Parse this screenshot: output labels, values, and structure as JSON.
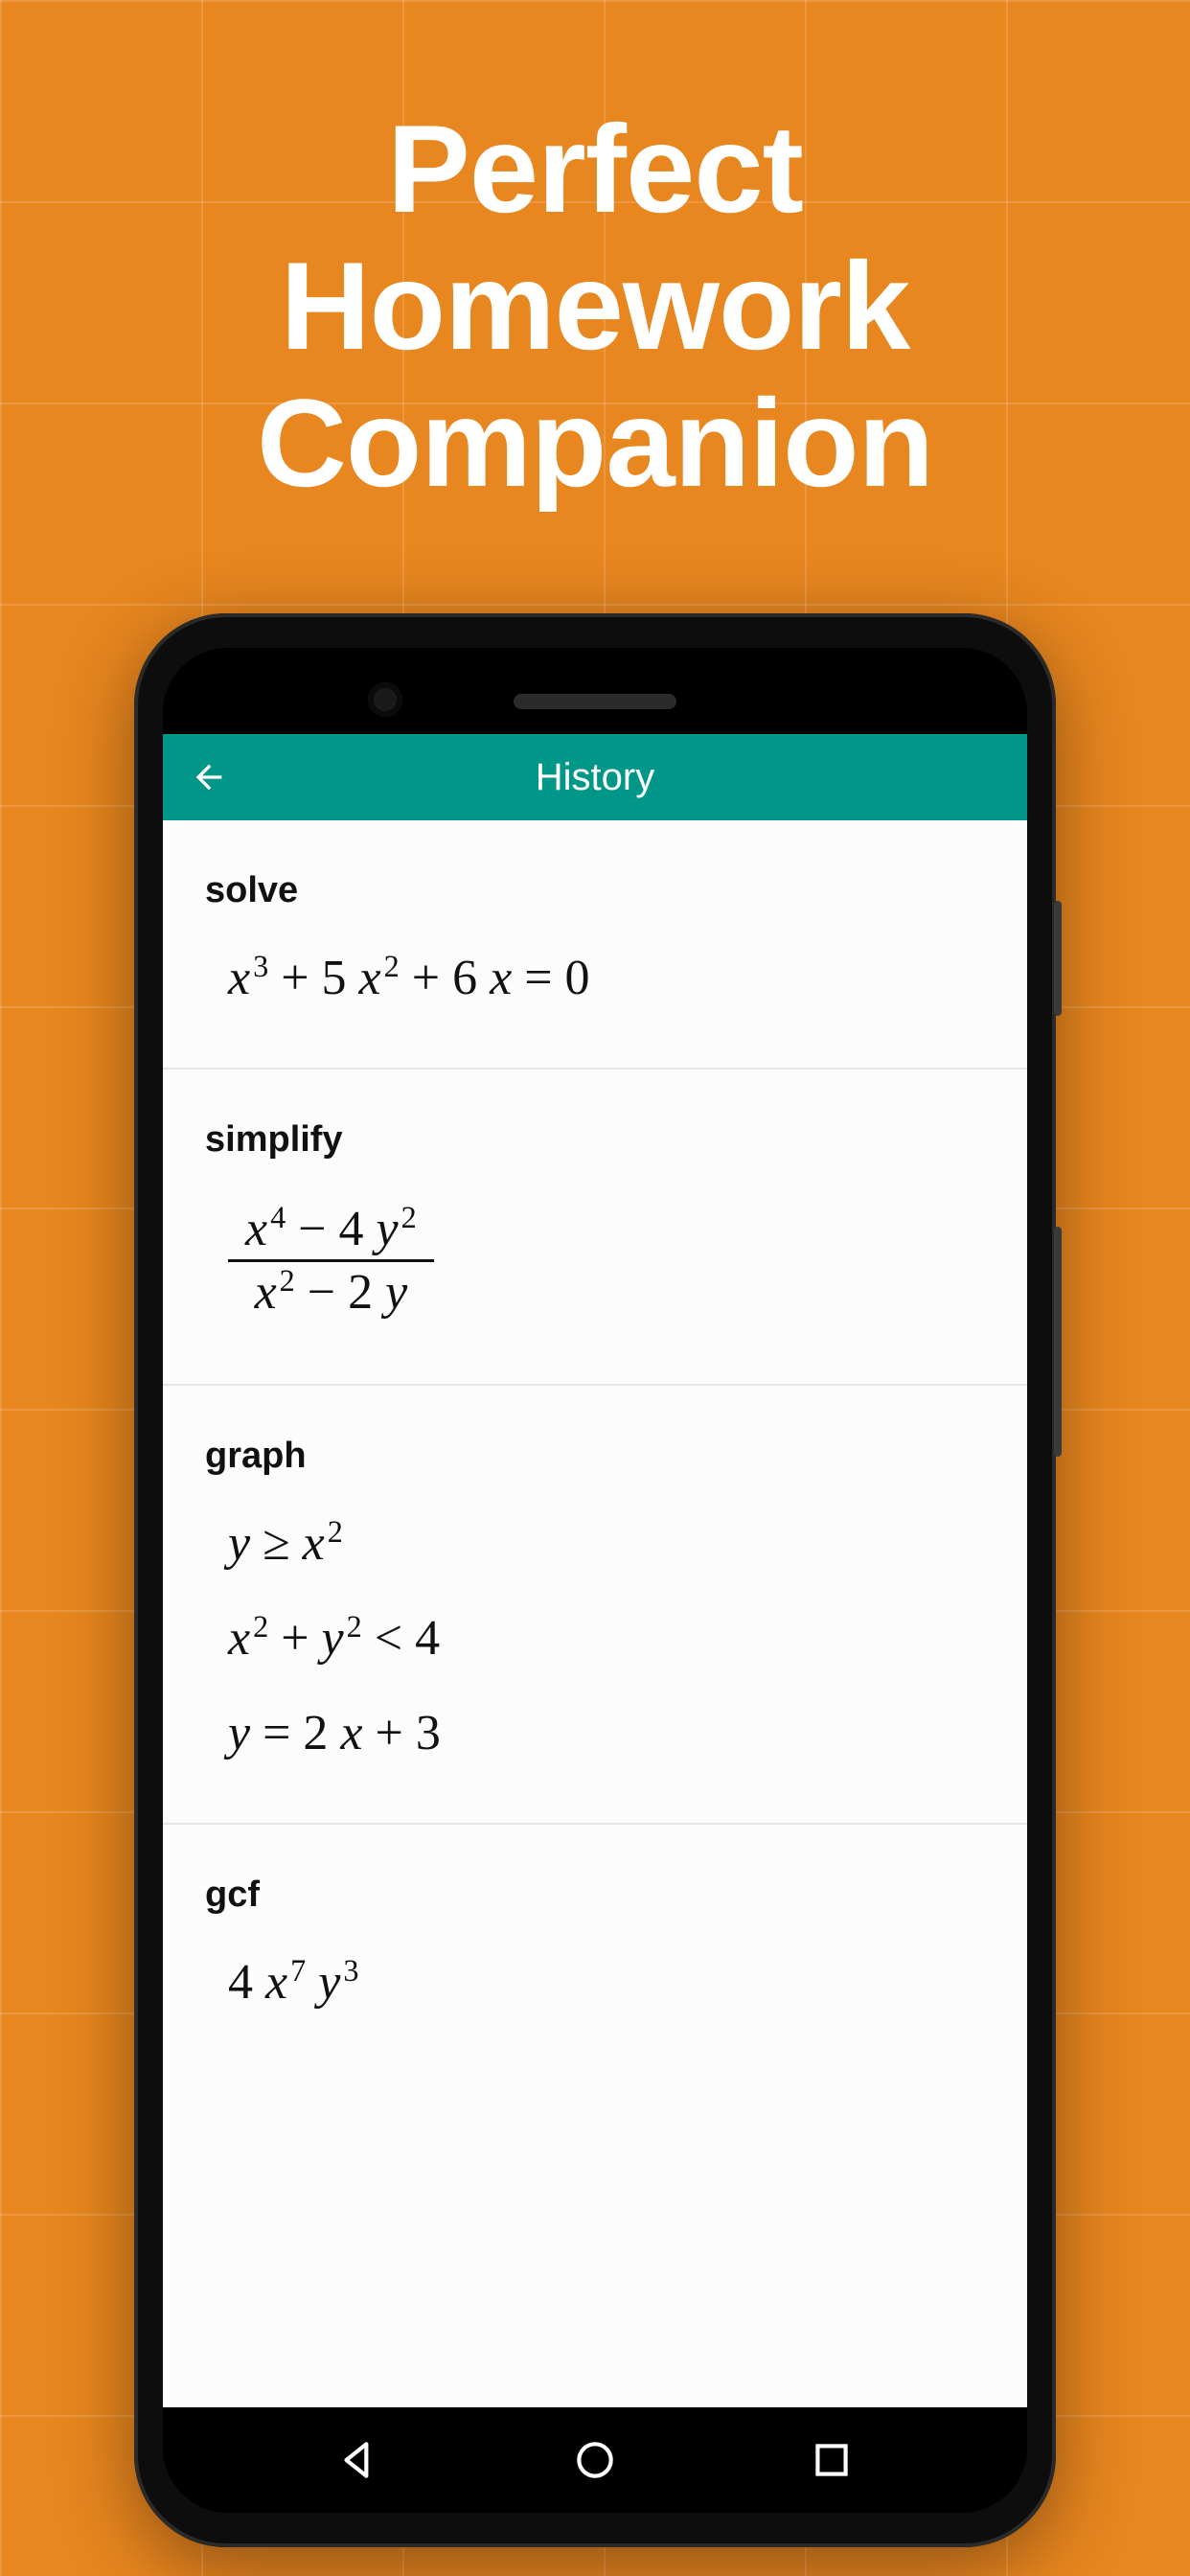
{
  "promo": {
    "headline_line1": "Perfect",
    "headline_line2": "Homework",
    "headline_line3": "Companion"
  },
  "app": {
    "header_title": "History"
  },
  "history": {
    "items": [
      {
        "label": "solve"
      },
      {
        "label": "simplify"
      },
      {
        "label": "graph"
      },
      {
        "label": "gcf"
      }
    ]
  },
  "equations": {
    "solve_x": "x",
    "solve_exp1": "3",
    "solve_plus5": " + 5 ",
    "solve_exp2": "2",
    "solve_plus6": " + 6 ",
    "solve_eq0": " = 0",
    "simp_x": "x",
    "simp_exp4": "4",
    "simp_minus4": " − 4 ",
    "simp_y": "y",
    "simp_exp2": "2",
    "simp_minus2": " − 2 ",
    "g1_y": "y",
    "g1_ge": " ≥ ",
    "g1_x": "x",
    "g1_exp2": "2",
    "g2_x": "x",
    "g2_plus": " + ",
    "g2_y": "y",
    "g2_lt4": " < 4",
    "g3_y": "y",
    "g3_eq": " = 2 ",
    "g3_x": "x",
    "g3_plus3": " + 3",
    "gcf_4": "4 ",
    "gcf_x": "x",
    "gcf_exp7": "7",
    "gcf_sp": "  ",
    "gcf_y": "y",
    "gcf_exp3": "3"
  }
}
